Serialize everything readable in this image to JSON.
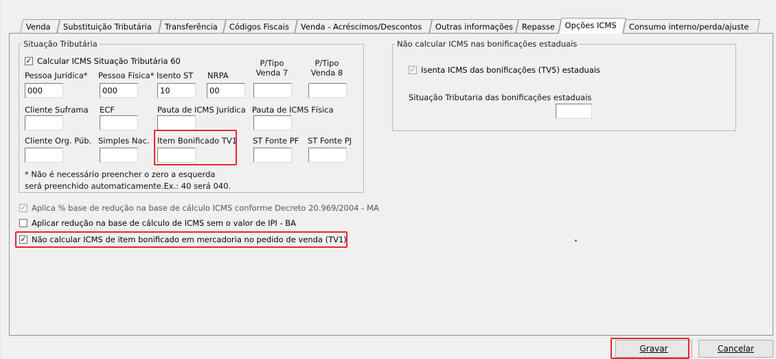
{
  "tabs": [
    {
      "label": "Venda",
      "active": false
    },
    {
      "label": "Substituição Tributária",
      "active": false
    },
    {
      "label": "Transferência",
      "active": false
    },
    {
      "label": "Códigos Fiscais",
      "active": false
    },
    {
      "label": "Venda - Acréscimos/Descontos",
      "active": false
    },
    {
      "label": "Outras informações",
      "active": false
    },
    {
      "label": "Repasse",
      "active": false
    },
    {
      "label": "Opções ICMS",
      "active": true
    },
    {
      "label": "Consumo interno/perda/ajuste",
      "active": false
    }
  ],
  "situacao": {
    "title": "Situação Tributária",
    "calc60_label": "Calcular ICMS Situação Tributária 60",
    "calc60_checked": true,
    "pj_label": "Pessoa Jurídica*",
    "pj_value": "000",
    "pf_label": "Pessoa Física*",
    "pf_value": "000",
    "isento_label": "Isento ST",
    "isento_value": "10",
    "nrpa_label": "NRPA",
    "nrpa_value": "00",
    "venda7_label": "P/Tipo\nVenda 7",
    "venda7_value": "",
    "venda8_label": "P/Tipo\nVenda 8",
    "venda8_value": "",
    "suframa_label": "Cliente Suframa",
    "suframa_value": "",
    "ecf_label": "ECF",
    "ecf_value": "",
    "pauta_pj_label": "Pauta de ICMS Jurídica",
    "pauta_pj_value": "",
    "pauta_pf_label": "Pauta de ICMS Física",
    "pauta_pf_value": "",
    "org_pub_label": "Cliente Org. Púb.",
    "org_pub_value": "",
    "simples_label": "Simples Nac.",
    "simples_value": "",
    "item_bon_label": "Item Bonificado TV1",
    "item_bon_value": "",
    "st_pf_label": "ST Fonte PF",
    "st_pf_value": "",
    "st_pj_label": "ST Fonte PJ",
    "st_pj_value": "",
    "note_line1": "* Não é necessário preencher o zero a esquerda",
    "note_line2": "será preenchido automaticamente.Ex.: 40 será 040."
  },
  "bonificacoes": {
    "title": "Não calcular ICMS nas bonificações estaduais",
    "isenta_label": "Isenta ICMS das bonificações (TV5) estaduais",
    "isenta_checked": true,
    "situacao_label": "Situação Tributaria das  bonificações estaduais",
    "situacao_value": ""
  },
  "options": [
    {
      "label": "Aplica % base de redução na base de cálculo ICMS conforme Decreto 20.969/2004 - MA",
      "checked": true,
      "disabled": true
    },
    {
      "label": "Aplicar redução na base de cálculo de ICMS sem o valor de IPI - BA",
      "checked": false,
      "disabled": false
    },
    {
      "label": "Não calcular ICMS de item bonificado em mercadoria no pedido de venda (TV1)",
      "checked": true,
      "disabled": false
    }
  ],
  "check_glyph": "✓",
  "buttons": {
    "gravar": "Gravar",
    "cancelar": "Cancelar"
  },
  "colors": {
    "highlight": "#e5262c"
  }
}
